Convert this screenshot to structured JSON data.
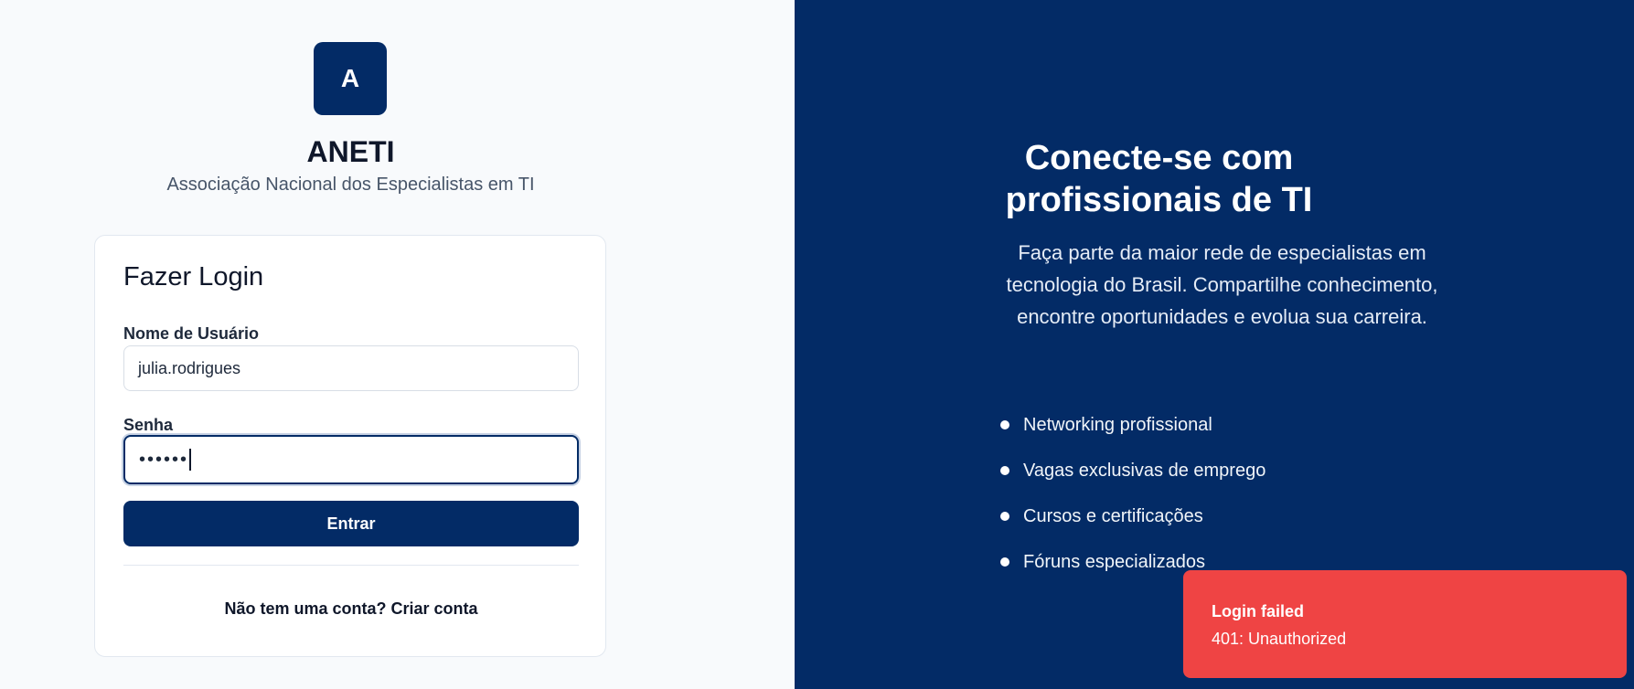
{
  "brand": {
    "logo_letter": "A",
    "name": "ANETI",
    "tagline": "Associação Nacional dos Especialistas em TI"
  },
  "login": {
    "title": "Fazer Login",
    "username_label": "Nome de Usuário",
    "username_value": "julia.rodrigues",
    "password_label": "Senha",
    "password_mask": "••••••",
    "submit_label": "Entrar",
    "signup_prompt": "Não tem uma conta?",
    "signup_link": "Criar conta"
  },
  "hero": {
    "title_line1": "Conecte-se com",
    "title_line2": "profissionais de TI",
    "description": "Faça parte da maior rede de especialistas em tecnologia do Brasil. Compartilhe conhecimento, encontre oportunidades e evolua sua carreira.",
    "features": [
      "Networking profissional",
      "Vagas exclusivas de emprego",
      "Cursos e certificações",
      "Fóruns especializados"
    ]
  },
  "toast": {
    "title": "Login failed",
    "message": "401: Unauthorized"
  },
  "colors": {
    "primary": "#032b66",
    "error": "#ef4444",
    "background": "#f8fafc"
  }
}
